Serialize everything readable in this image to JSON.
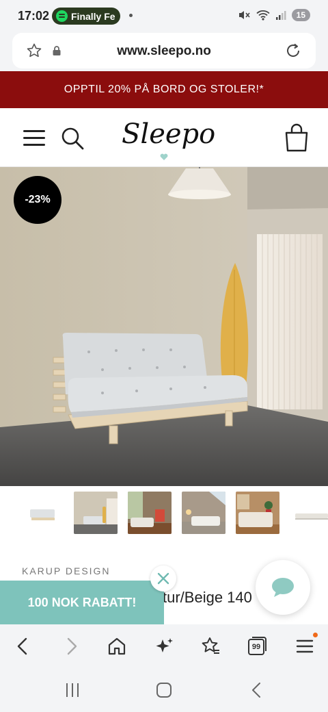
{
  "status_bar": {
    "time": "17:02",
    "now_playing": "Finally Fe",
    "battery": "15"
  },
  "browser": {
    "url": "www.sleepo.no"
  },
  "promo_banner": {
    "text": "OPPTIL 20% PÅ BORD OG STOLER!*"
  },
  "header": {
    "logo": "Sleepo"
  },
  "product": {
    "discount_badge": "-23%",
    "brand": "KARUP DESIGN",
    "title_visible": "tur/Beige 140"
  },
  "rabatt_popup": {
    "label": "100 NOK RABATT!"
  },
  "colors": {
    "promo_bg": "#8b0d0d",
    "rabatt_bg": "#7ec3bb",
    "chat_icon": "#8fcac2",
    "notif_dot": "#f06a1a"
  },
  "icons": {
    "browser_nav": [
      "back-icon",
      "forward-icon",
      "home-icon",
      "ai-sparkle-icon",
      "bookmarks-icon",
      "tabs-icon",
      "menu-icon"
    ],
    "system_nav": [
      "recents-icon",
      "home-button-icon",
      "back-button-icon"
    ]
  },
  "browser_nav": {
    "tabs_count": "99"
  }
}
